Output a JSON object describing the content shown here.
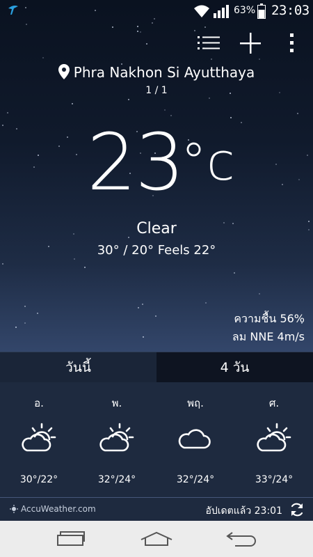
{
  "status_bar": {
    "battery_percent": "63%",
    "time": "23:03",
    "icons": [
      "carrier-icon",
      "wifi-icon",
      "signal-icon",
      "battery-icon"
    ]
  },
  "toolbar": {
    "icons": [
      "list-icon",
      "add-icon",
      "more-icon"
    ]
  },
  "location": {
    "name": "Phra Nakhon Si Ayutthaya",
    "page_indicator": "1 / 1"
  },
  "current": {
    "temperature": "23",
    "unit": "°c",
    "condition": "Clear",
    "hi_lo_feels": "30° / 20° Feels 22°",
    "humidity_label": "ความชื้น",
    "humidity_value": "56%",
    "wind_label": "ลม",
    "wind_value": "NNE 4m/s"
  },
  "tabs": {
    "today": "วันนี้",
    "four_day": "4 วัน"
  },
  "forecast": [
    {
      "day": "อ.",
      "temp": "30°/22°",
      "icon": "partly-cloudy-sun-icon"
    },
    {
      "day": "พ.",
      "temp": "32°/24°",
      "icon": "partly-cloudy-sun-icon"
    },
    {
      "day": "พฤ.",
      "temp": "32°/24°",
      "icon": "cloud-icon"
    },
    {
      "day": "ศ.",
      "temp": "33°/24°",
      "icon": "partly-cloudy-sun-icon"
    }
  ],
  "footer": {
    "provider": "AccuWeather.com",
    "updated": "อัปเดตแล้ว 23:01"
  },
  "navbar": {
    "icons": [
      "recent-apps-icon",
      "home-icon",
      "back-icon"
    ]
  },
  "colors": {
    "forecast_bg": "#1e2a3f",
    "carrier": "#2aa0e0",
    "navbar_bg": "#ececec"
  }
}
